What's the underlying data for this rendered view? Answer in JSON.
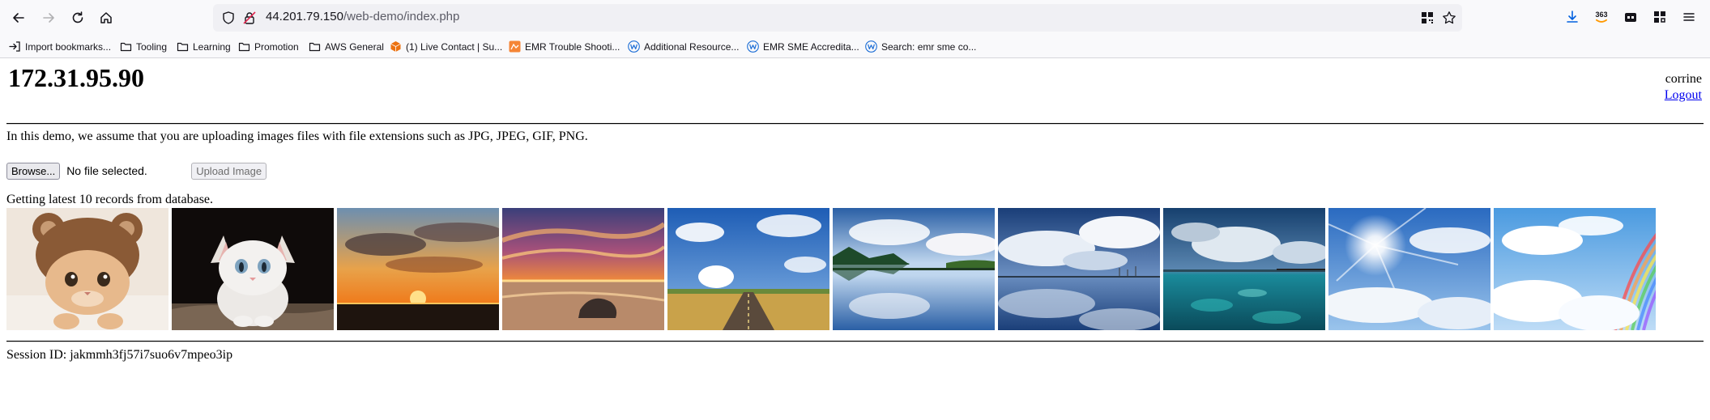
{
  "browser": {
    "url_host": "44.201.79.150",
    "url_path": "/web-demo/index.php",
    "toolbar_badge": "363",
    "bookmarks": [
      {
        "label": "Import bookmarks...",
        "icon": "import-icon"
      },
      {
        "label": "Tooling",
        "icon": "folder-icon"
      },
      {
        "label": "Learning",
        "icon": "folder-icon"
      },
      {
        "label": "Promotion",
        "icon": "folder-icon"
      },
      {
        "label": "AWS General",
        "icon": "folder-icon"
      },
      {
        "label": "(1) Live Contact | Su...",
        "icon": "aws-cube-icon"
      },
      {
        "label": "EMR Trouble Shooti...",
        "icon": "emr-icon"
      },
      {
        "label": "Additional Resource...",
        "icon": "w-icon"
      },
      {
        "label": "EMR SME Accredita...",
        "icon": "w-icon"
      },
      {
        "label": "Search: emr sme co...",
        "icon": "w-icon"
      }
    ]
  },
  "page": {
    "server_ip": "172.31.95.90",
    "username": "corrine",
    "logout_label": "Logout",
    "info_text": "In this demo, we assume that you are uploading images files with file extensions such as JPG, JPEG, GIF, PNG.",
    "browse_label": "Browse...",
    "file_status": "No file selected.",
    "upload_label": "Upload Image",
    "records_text": "Getting latest 10 records from database.",
    "session_text": "Session ID: jakmmh3fj57i7suo6v7mpeo3ip"
  },
  "gallery": [
    {
      "subject": "kitten wearing bear hat",
      "icon": "kitten-bear-hat-image"
    },
    {
      "subject": "white kitten",
      "icon": "kitten-image"
    },
    {
      "subject": "orange sunset with clouds",
      "icon": "sunset-image"
    },
    {
      "subject": "purple sunset over beach",
      "icon": "beach-sunset-image"
    },
    {
      "subject": "road under blue sky",
      "icon": "road-sky-image"
    },
    {
      "subject": "lake reflecting clouds",
      "icon": "lake-reflection-image"
    },
    {
      "subject": "dramatic clouds over water",
      "icon": "clouds-water-image"
    },
    {
      "subject": "turquoise sea with clouds",
      "icon": "turquoise-sea-image"
    },
    {
      "subject": "bright sun in clouds",
      "icon": "sun-clouds-image"
    },
    {
      "subject": "clouds with rainbow",
      "icon": "rainbow-clouds-image"
    }
  ]
}
